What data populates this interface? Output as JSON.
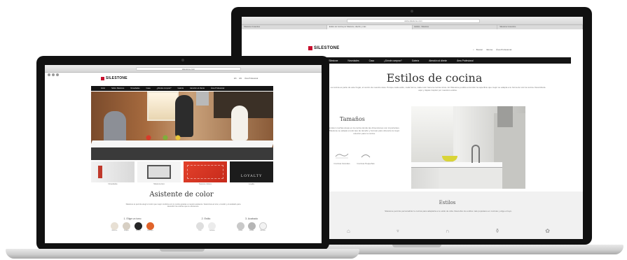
{
  "brand": {
    "name": "SILESTONE",
    "red": "#c8102e"
  },
  "right_laptop": {
    "tabs": [
      "Silestone Cosentino",
      "Estilos de Cocina por Silestone, diseño y más",
      "Estilos - Silestone",
      "Silestone Cosentino"
    ],
    "url": "www.silestone.com",
    "utility": [
      "Buscar",
      "Idioma",
      "Área Profesional"
    ],
    "nav": [
      "Inicio Silestone",
      "Novedades",
      "Casa",
      "¿Dónde comprar?",
      "Galería",
      "Atención al cliente",
      "Área Profesional"
    ],
    "page_title": "Estilos de cocina",
    "intro": "La cocina es parte de este hogar, el centro de nuestra casa. Porque cada estilo, cada forma, cada color hace la cocina única. En Silestone podrás encontrar la superficie que mejor se adapta a tu forma de vivir la cocina. Descúbrela aquí y déjate inspirar por nuestros estilos.",
    "section_tamanos": {
      "heading": "Tamaños",
      "text": "Existen muchas áreas en la cocina donde las dimensiones son importantes. Silestone se adapta a todo tipo de tamaño y formato para ofrecerte la mejor solución para tu cocina.",
      "options": [
        "Cocinas Grandes",
        "Cocinas Pequeñas"
      ]
    },
    "section_estilos": {
      "heading": "Estilos",
      "text": "Silestone permite personalizar tu cocina para adaptarla a tu estilo de vida. Descubre los estilos más populares en cocinas y elige el tuyo."
    }
  },
  "left_laptop": {
    "url": "silestone.com",
    "utility": [
      "ES",
      "EN",
      "Área Profesional"
    ],
    "nav": [
      "Inicio",
      "Sobre Silestone",
      "Novedades",
      "Casa",
      "¿Dónde comprar?",
      "Galería",
      "Atención al cliente",
      "Área Profesional"
    ],
    "thumbs": [
      "Novedades",
      "Silestone Eco",
      "Nuevos colores",
      "Loyalty"
    ],
    "loyalty_text": "LOYALTY",
    "heading": "Asistente de color",
    "intro": "Silestone te permite elegir el color que mejor combina con tu cocina gracias a nuestro asistente. Selecciona el tono, el estilo y el acabado para descubrir los colores que te ofrecemos.",
    "steps": [
      {
        "label": "1. Elige un tono",
        "swatches": [
          "#e8e0d4",
          "#d7cfc3",
          "#262626",
          "#e0632a"
        ],
        "names": [
          "Blancos",
          "Beiges",
          "Negros",
          "Naranjas"
        ]
      },
      {
        "label": "2. Estilo",
        "swatches": [
          "#dedede",
          "#ececec"
        ],
        "names": [
          "Liso",
          "Veteado"
        ]
      },
      {
        "label": "3. Acabado",
        "swatches": [
          "#c9c9c9",
          "#b5b5b5",
          "#f3f3f3"
        ],
        "names": [
          "Pulido",
          "Suede",
          "Volcano"
        ]
      }
    ]
  }
}
